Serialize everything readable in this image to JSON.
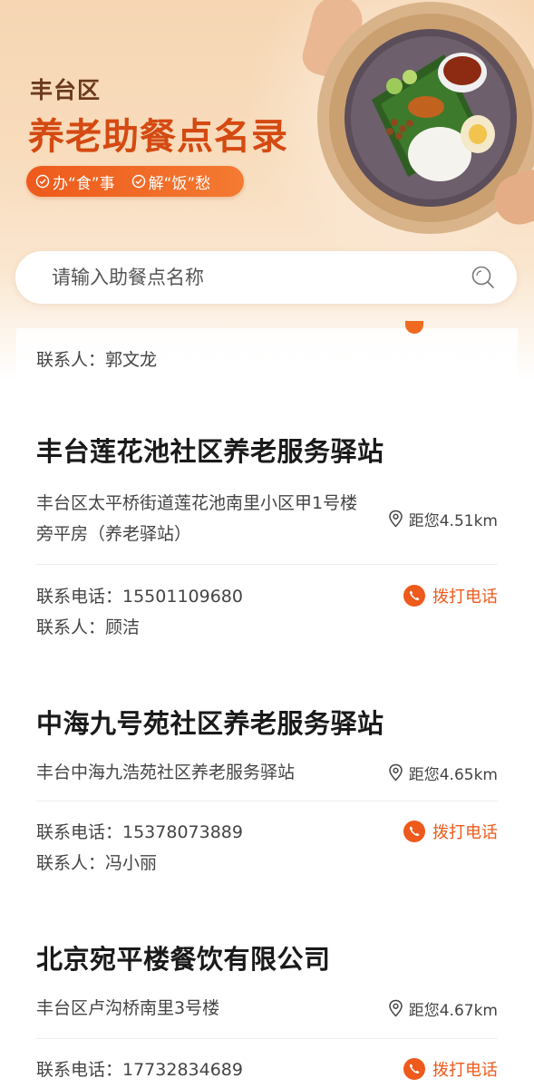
{
  "header": {
    "district": "丰台区",
    "title": "养老助餐点名录",
    "slogans": [
      "办“食”事",
      "解“饭”愁"
    ]
  },
  "search": {
    "placeholder": "请输入助餐点名称"
  },
  "partial_card": {
    "contact": "联系人：郭文龙"
  },
  "labels": {
    "call": "拨打电话"
  },
  "cards": [
    {
      "name": "丰台莲花池社区养老服务驿站",
      "address": "丰台区太平桥街道莲花池南里小区甲1号楼旁平房（养老驿站）",
      "distance": "距您4.51km",
      "phone": "联系电话：15501109680",
      "contact": "联系人：顾洁"
    },
    {
      "name": "中海九号苑社区养老服务驿站",
      "address": "丰台中海九浩苑社区养老服务驿站",
      "distance": "距您4.65km",
      "phone": "联系电话：15378073889",
      "contact": "联系人：冯小丽"
    },
    {
      "name": "北京宛平楼餐饮有限公司",
      "address": "丰台区卢沟桥南里3号楼",
      "distance": "距您4.67km",
      "phone": "联系电话：17732834689"
    }
  ],
  "colors": {
    "accent": "#ee5a1b",
    "title": "#d44a12",
    "district": "#6b3a1c"
  },
  "icons": [
    "check-circle-icon",
    "search-icon",
    "location-pin-icon",
    "phone-icon"
  ]
}
